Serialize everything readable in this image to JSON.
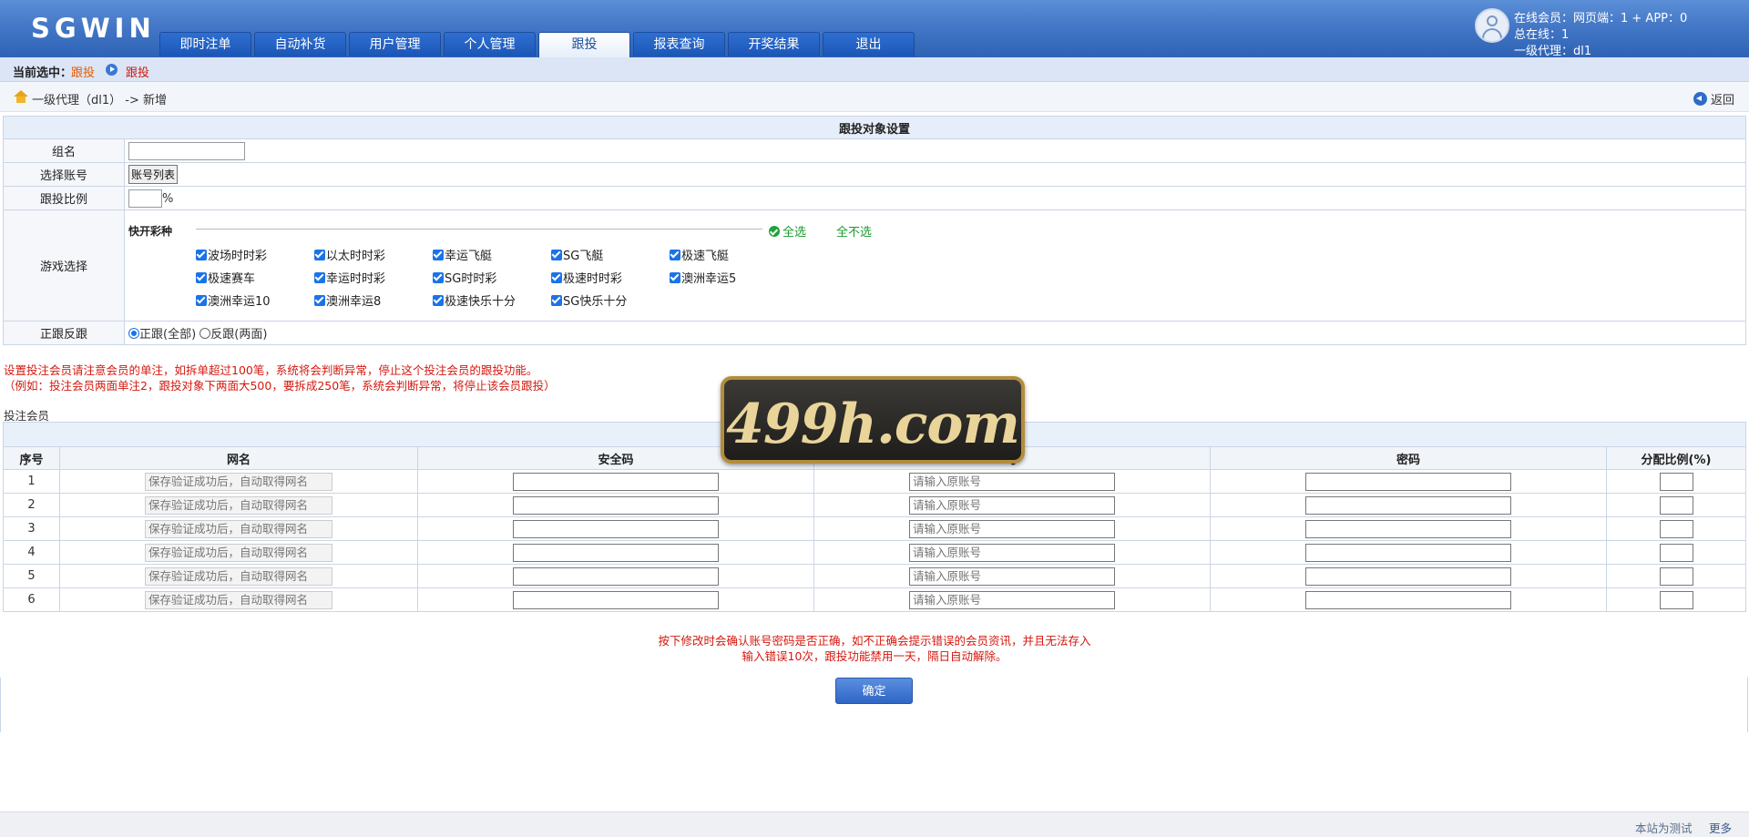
{
  "header": {
    "logo": "SGWIN",
    "nav": [
      "即时注单",
      "自动补货",
      "用户管理",
      "个人管理",
      "跟投",
      "报表查询",
      "开奖结果",
      "退出"
    ],
    "active_nav": "跟投",
    "user": {
      "online": "在线会员：网页端：1 + APP：0",
      "total": "总在线：1",
      "agent": "一级代理：dl1"
    }
  },
  "current": {
    "label": "当前选中：",
    "item1": "跟投",
    "item2": "跟投"
  },
  "breadcrumb": {
    "path": "一级代理（dl1） -> 新增",
    "back": "返回"
  },
  "settings": {
    "title": "跟投对象设置",
    "group_label": "组名",
    "group_value": "",
    "account_label": "选择账号",
    "account_button": "账号列表",
    "ratio_label": "跟投比例",
    "ratio_value": "",
    "ratio_unit": "%",
    "games_label": "游戏选择",
    "category": "快开彩种",
    "select_all": "全选",
    "select_none": "全不选",
    "games": [
      "波场时时彩",
      "以太时时彩",
      "幸运飞艇",
      "SG飞艇",
      "极速飞艇",
      "极速赛车",
      "幸运时时彩",
      "SG时时彩",
      "极速时时彩",
      "澳洲幸运5",
      "澳洲幸运10",
      "澳洲幸运8",
      "极速快乐十分",
      "SG快乐十分"
    ],
    "direction_label": "正跟反跟",
    "direction_options": [
      "正跟(全部)",
      "反跟(两面)"
    ],
    "direction_selected": "正跟(全部)"
  },
  "warnings": [
    "设置投注会员请注意会员的单注，如拆单超过100笔，系统将会判断异常，停止这个投注会员的跟投功能。",
    "（例如：投注会员两面单注2，跟投对象下两面大500，要拆成250笔，系统会判断异常，将停止该会员跟投）"
  ],
  "members": {
    "title": "投注会员",
    "columns": [
      "序号",
      "网名",
      "安全码",
      "号",
      "密码",
      "分配比例(%)"
    ],
    "name_placeholder": "保存验证成功后，自动取得网名",
    "account_placeholder": "请输入原账号",
    "rows": [
      "1",
      "2",
      "3",
      "4",
      "5",
      "6"
    ]
  },
  "notes": [
    "按下修改时会确认账号密码是否正确，如不正确会提示错误的会员资讯，并且无法存入",
    "输入错误10次，跟投功能禁用一天，隔日自动解除。"
  ],
  "confirm": "确定",
  "watermark": "499h.com",
  "footer": {
    "speed": "本站为测试",
    "more": "更多"
  }
}
